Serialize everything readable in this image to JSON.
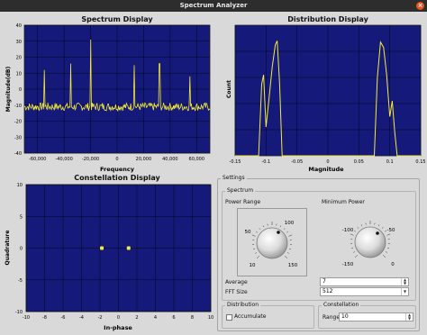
{
  "window": {
    "title": "Spectrum Analyzer",
    "close_glyph": "×"
  },
  "colors": {
    "plot_bg": "#14197a",
    "trace": "#f5ec3a",
    "grid": "#000000"
  },
  "spectrum": {
    "title": "Spectrum Display",
    "xlabel": "Frequency",
    "ylabel": "Magnitude(dB)",
    "xticks": [
      "-60,000",
      "-40,000",
      "-20,000",
      "0",
      "20,000",
      "40,000",
      "60,000"
    ],
    "yticks": [
      "40",
      "30",
      "20",
      "10",
      "0",
      "-10",
      "-20",
      "-30",
      "-40"
    ]
  },
  "distribution": {
    "title": "Distribution Display",
    "xlabel": "Magnitude",
    "ylabel": "Count",
    "xticks": [
      "-0.15",
      "-0.1",
      "-0.05",
      "0",
      "0.05",
      "0.1",
      "0.15"
    ]
  },
  "constellation": {
    "title": "Constellation Display",
    "xlabel": "In-phase",
    "ylabel": "Quadrature",
    "xticks": [
      "-10",
      "-8",
      "-6",
      "-4",
      "-2",
      "0",
      "2",
      "4",
      "6",
      "8",
      "10"
    ],
    "yticks": [
      "10",
      "5",
      "0",
      "-5",
      "-10"
    ]
  },
  "chart_data": [
    {
      "type": "line",
      "title": "Spectrum Display",
      "xlabel": "Frequency",
      "ylabel": "Magnitude(dB)",
      "xlim": [
        -70000,
        70000
      ],
      "ylim": [
        -40,
        40
      ],
      "grid": true,
      "noise_floor_db": -11,
      "peaks": [
        {
          "x": -55000,
          "y": 12
        },
        {
          "x": -35000,
          "y": 16
        },
        {
          "x": -20000,
          "y": 31
        },
        {
          "x": 13000,
          "y": 15
        },
        {
          "x": 32000,
          "y": 16
        },
        {
          "x": 55000,
          "y": 8
        }
      ]
    },
    {
      "type": "line",
      "title": "Distribution Display",
      "xlabel": "Magnitude",
      "ylabel": "Count",
      "xlim": [
        -0.15,
        0.15
      ],
      "grid": true,
      "points": [
        [
          -0.112,
          0.0
        ],
        [
          -0.107,
          0.55
        ],
        [
          -0.104,
          0.62
        ],
        [
          -0.1,
          0.22
        ],
        [
          -0.095,
          0.45
        ],
        [
          -0.09,
          0.68
        ],
        [
          -0.085,
          0.85
        ],
        [
          -0.082,
          0.88
        ],
        [
          -0.078,
          0.55
        ],
        [
          -0.074,
          0.0
        ],
        [
          0.075,
          0.0
        ],
        [
          0.08,
          0.6
        ],
        [
          0.085,
          0.87
        ],
        [
          0.09,
          0.83
        ],
        [
          0.095,
          0.62
        ],
        [
          0.1,
          0.3
        ],
        [
          0.104,
          0.42
        ],
        [
          0.108,
          0.18
        ],
        [
          0.112,
          0.0
        ]
      ]
    },
    {
      "type": "scatter",
      "title": "Constellation Display",
      "xlabel": "In-phase",
      "ylabel": "Quadrature",
      "xlim": [
        -10,
        10
      ],
      "ylim": [
        -10,
        10
      ],
      "grid": true,
      "points": [
        [
          -1.8,
          0.0
        ],
        [
          1.1,
          0.0
        ]
      ]
    }
  ],
  "settings": {
    "title": "Settings",
    "spectrum_group": "Spectrum",
    "power_range": {
      "label": "Power Range",
      "ticks": [
        "100",
        "50",
        "10",
        "150"
      ]
    },
    "minimum_power": {
      "label": "Minimum Power",
      "ticks": [
        "-100",
        "-50",
        "0",
        "-150"
      ]
    },
    "average": {
      "label": "Average",
      "value": "7"
    },
    "fft_size": {
      "label": "FFT Size",
      "value": "512"
    },
    "distribution_group": "Distribution",
    "accumulate_label": "Accumulate",
    "constellation_group": "Constellation",
    "range": {
      "label": "Range",
      "value": "10"
    },
    "spin_up": "▲",
    "spin_down": "▼"
  }
}
